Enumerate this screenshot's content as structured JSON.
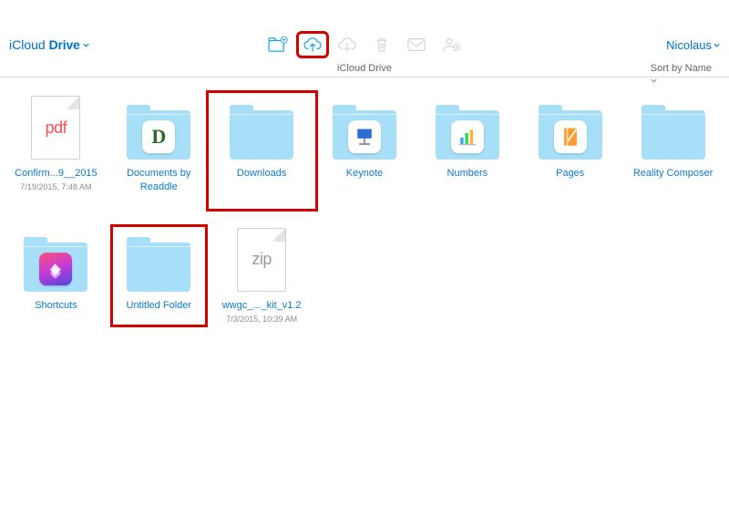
{
  "colors": {
    "link": "#0070c9",
    "highlight": "#d40000",
    "folder": "#a6dff7"
  },
  "header": {
    "brand_prefix": "iCloud",
    "brand_strong": "Drive",
    "account_name": "Nicolaus"
  },
  "toolbar": {
    "items": [
      {
        "id": "new-folder-icon",
        "active": true,
        "highlight": false
      },
      {
        "id": "cloud-upload-icon",
        "active": true,
        "highlight": true
      },
      {
        "id": "download-icon",
        "active": false,
        "highlight": false
      },
      {
        "id": "trash-icon",
        "active": false,
        "highlight": false
      },
      {
        "id": "mail-icon",
        "active": false,
        "highlight": false
      },
      {
        "id": "share-person-icon",
        "active": false,
        "highlight": false
      }
    ]
  },
  "subheader": {
    "location": "iCloud Drive",
    "sort_label": "Sort by Name"
  },
  "items": [
    {
      "kind": "file-pdf",
      "label": "Confirm...9__2015",
      "sublabel": "7/19/2015, 7:48 AM",
      "overlay_text": "pdf",
      "highlight": false
    },
    {
      "kind": "folder-app",
      "label": "Documents by Readdle",
      "sublabel": "",
      "overlay_text": "D",
      "overlay_style": "readdle",
      "highlight": false
    },
    {
      "kind": "folder",
      "label": "Downloads",
      "sublabel": "",
      "highlight": true,
      "highlight_tight": false
    },
    {
      "kind": "folder-keynote",
      "label": "Keynote",
      "sublabel": "",
      "highlight": false
    },
    {
      "kind": "folder-numbers",
      "label": "Numbers",
      "sublabel": "",
      "highlight": false
    },
    {
      "kind": "folder-pages",
      "label": "Pages",
      "sublabel": "",
      "highlight": false
    },
    {
      "kind": "folder",
      "label": "Reality Composer",
      "sublabel": "",
      "highlight": false
    },
    {
      "kind": "folder-shortcuts",
      "label": "Shortcuts",
      "sublabel": "",
      "overlay_style": "shortcuts",
      "highlight": false
    },
    {
      "kind": "folder",
      "label": "Untitled Folder",
      "sublabel": "",
      "highlight": true,
      "highlight_tight": true
    },
    {
      "kind": "file-zip",
      "label": "wwgc_..._kit_v1.2",
      "sublabel": "7/3/2015, 10:39 AM",
      "overlay_text": "zip",
      "highlight": false
    }
  ]
}
